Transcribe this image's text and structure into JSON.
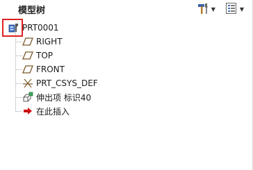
{
  "panel": {
    "title": "模型树"
  },
  "toolbar": {
    "settings_icon": "hammer-wrench-icon",
    "show_icon": "tree-filter-icon"
  },
  "tree": {
    "root": {
      "label": "PRT0001",
      "icon": "part-icon",
      "selected": true
    },
    "items": [
      {
        "label": "RIGHT",
        "icon": "datum-plane-icon"
      },
      {
        "label": "TOP",
        "icon": "datum-plane-icon"
      },
      {
        "label": "FRONT",
        "icon": "datum-plane-icon"
      },
      {
        "label": "PRT_CSYS_DEF",
        "icon": "coordinate-system-icon"
      },
      {
        "label": "伸出项 标识40",
        "icon": "extrude-icon"
      },
      {
        "label": "在此插入",
        "icon": "insert-here-arrow-icon"
      }
    ]
  },
  "colors": {
    "selection_border": "#e02020",
    "datum_plane": "#7a5a2a",
    "insert_arrow": "#cc1010"
  }
}
